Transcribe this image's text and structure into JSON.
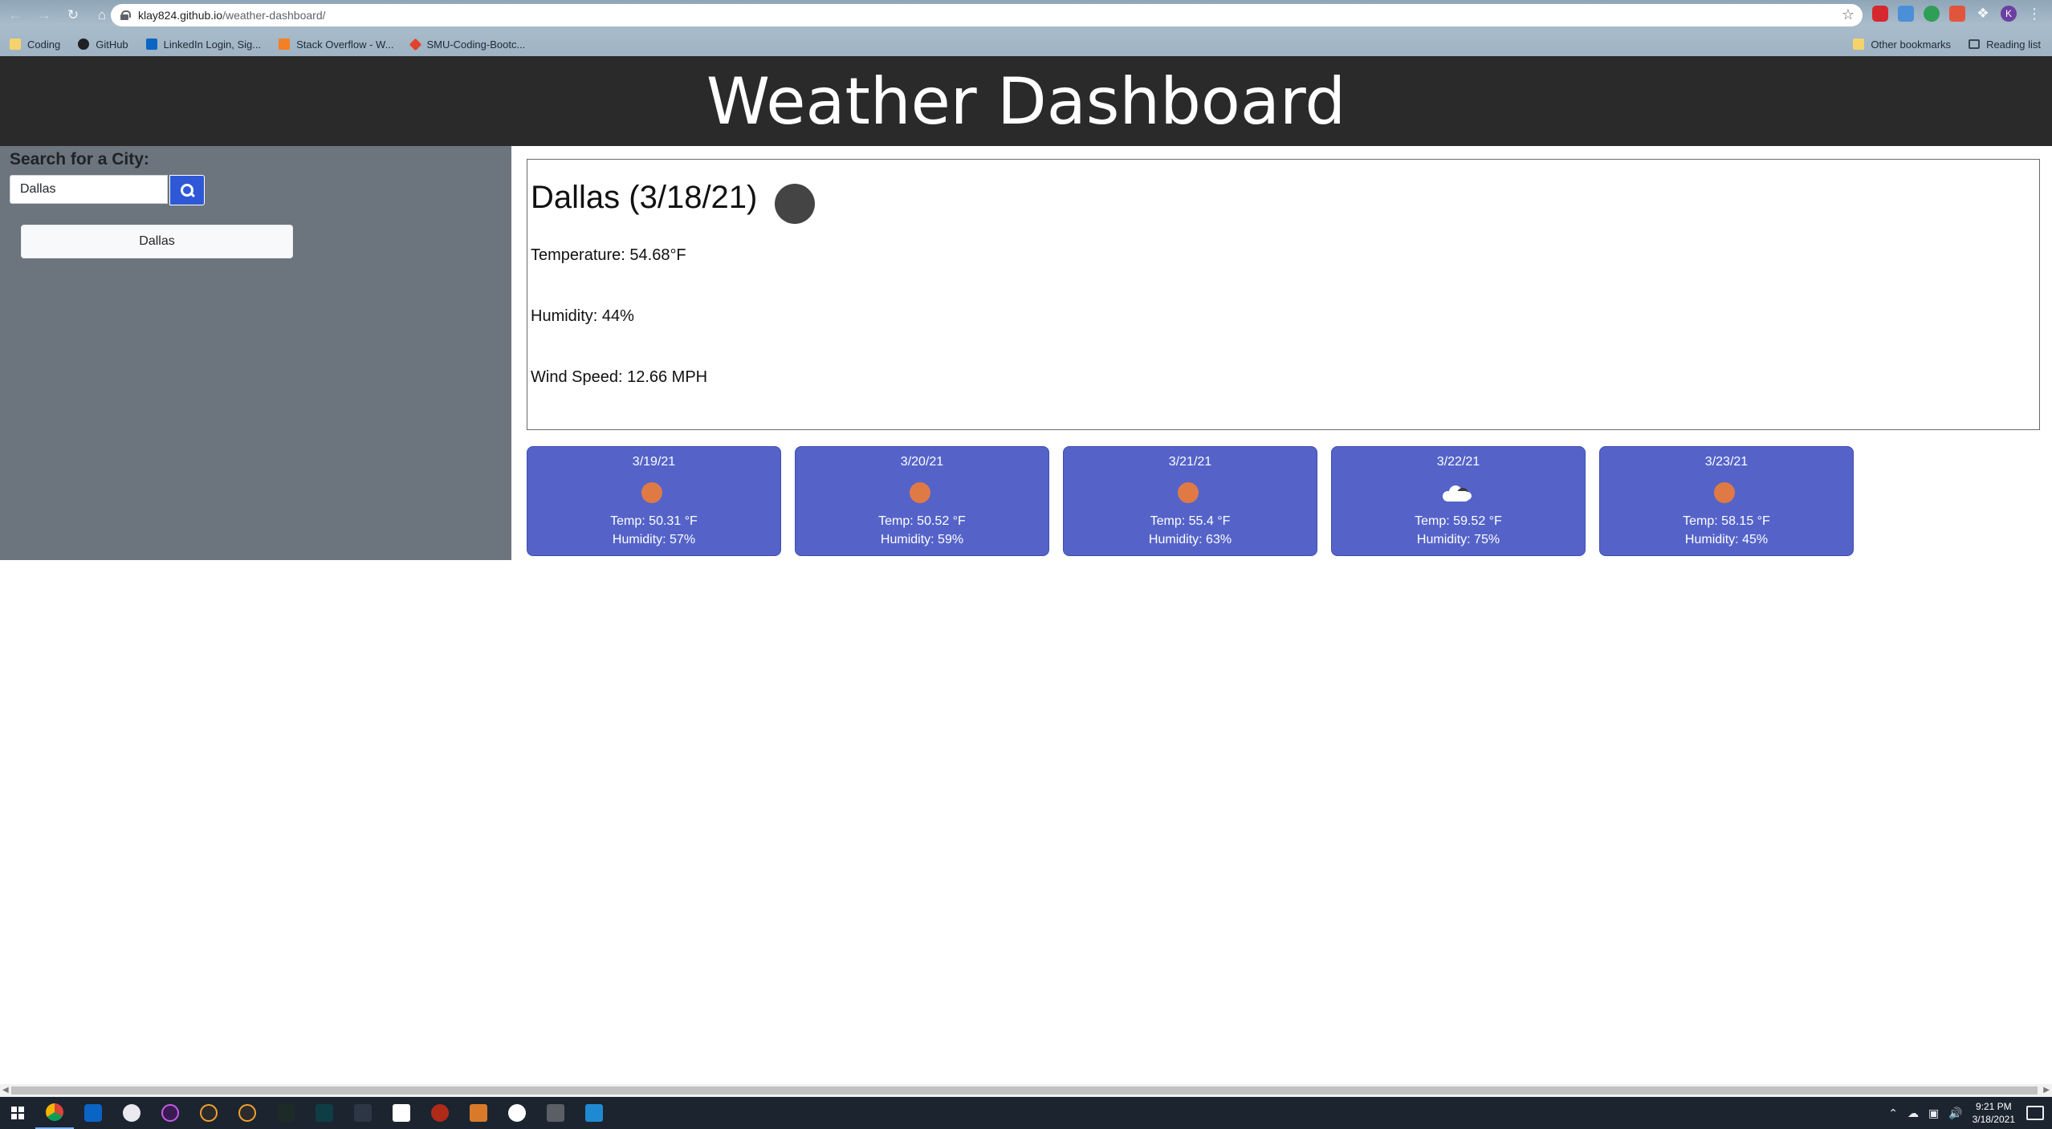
{
  "browser": {
    "url_host": "klay824.github.io",
    "url_path": "/weather-dashboard/",
    "bookmarks": [
      "Coding",
      "GitHub",
      "LinkedIn Login, Sig...",
      "Stack Overflow - W...",
      "SMU-Coding-Bootc..."
    ],
    "other_bookmarks": "Other bookmarks",
    "reading_list": "Reading list",
    "profile_initial": "K"
  },
  "header": {
    "title": "Weather Dashboard"
  },
  "sidebar": {
    "search_label": "Search for a City:",
    "search_value": "Dallas",
    "history": [
      "Dallas"
    ]
  },
  "current": {
    "title": "Dallas (3/18/21)",
    "temperature": "Temperature: 54.68°F",
    "humidity": "Humidity: 44%",
    "wind": "Wind Speed: 12.66 MPH",
    "icon": "dark-circle-icon"
  },
  "forecast": [
    {
      "date": "3/19/21",
      "icon": "sun-icon",
      "temp": "Temp: 50.31 °F",
      "humidity": "Humidity: 57%"
    },
    {
      "date": "3/20/21",
      "icon": "sun-icon",
      "temp": "Temp: 50.52 °F",
      "humidity": "Humidity: 59%"
    },
    {
      "date": "3/21/21",
      "icon": "sun-icon",
      "temp": "Temp: 55.4 °F",
      "humidity": "Humidity: 63%"
    },
    {
      "date": "3/22/21",
      "icon": "cloud-icon",
      "temp": "Temp: 59.52 °F",
      "humidity": "Humidity: 75%"
    },
    {
      "date": "3/23/21",
      "icon": "sun-icon",
      "temp": "Temp: 58.15 °F",
      "humidity": "Humidity: 45%"
    }
  ],
  "taskbar": {
    "time": "9:21 PM",
    "date": "3/18/2021"
  },
  "colors": {
    "header_bg": "#2b2a2a",
    "sidebar_bg": "#6c757d",
    "forecast_bg": "#5563c9",
    "search_button": "#2e58d6",
    "sun": "#e07a45"
  }
}
